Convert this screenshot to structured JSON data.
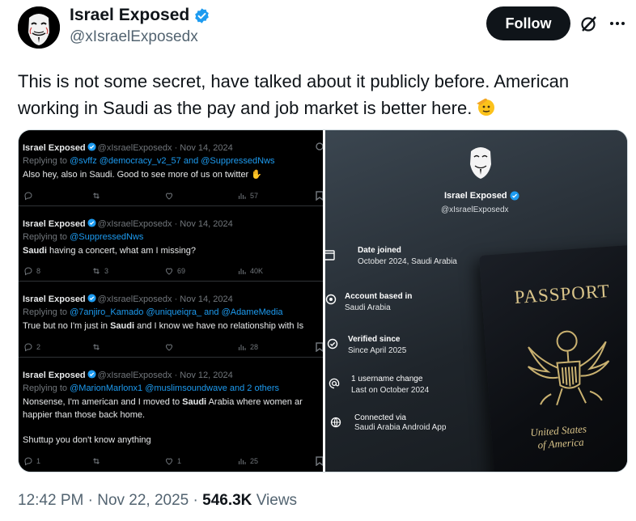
{
  "author": {
    "name": "Israel Exposed",
    "handle": "@xIsraelExposedx"
  },
  "header": {
    "follow_label": "Follow"
  },
  "tweet": {
    "text": "This is not some secret, have talked about it publicly before. American working in Saudi as the pay and job market is better here.",
    "emoji": "saluting-face"
  },
  "left_screenshot": {
    "replies": [
      {
        "name": "Israel Exposed",
        "meta": "@xIsraelExposedx · Nov 14, 2024",
        "replying_prefix": "Replying to",
        "mentions": "@svffz @democracy_v2_57 and @SuppressedNws",
        "body": "Also hey, also in Saudi. Good to see more of us on twitter",
        "replies_count": "",
        "reposts_count": "",
        "likes_count": "",
        "views_count": "57"
      },
      {
        "name": "Israel Exposed",
        "meta": "@xIsraelExposedx · Nov 14, 2024",
        "replying_prefix": "Replying to",
        "mentions": "@SuppressedNws",
        "body_bold": "Saudi",
        "body": "having a concert, what am I missing?",
        "replies_count": "8",
        "reposts_count": "3",
        "likes_count": "69",
        "views_count": "40K"
      },
      {
        "name": "Israel Exposed",
        "meta": "@xIsraelExposedx · Nov 14, 2024",
        "replying_prefix": "Replying to",
        "mentions": "@7anjiro_Kamado @uniqueiqra_ and @AdameMedia",
        "body_pre": "True but no I'm just in",
        "body_bold": "Saudi",
        "body_post": "and I know we have no relationship with Is",
        "replies_count": "2",
        "reposts_count": "",
        "likes_count": "",
        "views_count": "28"
      },
      {
        "name": "Israel Exposed",
        "meta": "@xIsraelExposedx · Nov 12, 2024",
        "replying_prefix": "Replying to",
        "mentions": "@MarionMarlonx1 @muslimsoundwave and 2 others",
        "body_pre": "Nonsense, I'm american and I moved to",
        "body_bold": "Saudi",
        "body_post": "Arabia where women ar",
        "body_line2": "happier than those back home.",
        "body_line3": "Shuttup you don't know anything",
        "replies_count": "1",
        "reposts_count": "",
        "likes_count": "1",
        "views_count": "25"
      }
    ]
  },
  "right_screenshot": {
    "name": "Israel Exposed",
    "handle": "@xIsraelExposedx",
    "info": [
      {
        "icon": "calendar-icon",
        "title": "Date joined",
        "value": "October 2024, Saudi Arabia"
      },
      {
        "icon": "location-icon",
        "title": "Account based in",
        "value": "Saudi Arabia"
      },
      {
        "icon": "verified-check-icon",
        "title": "Verified since",
        "value": "Since April 2025"
      },
      {
        "icon": "at-sign-icon",
        "title": "1 username change",
        "value": "Last on October 2024"
      },
      {
        "icon": "globe-icon",
        "title": "Connected via",
        "value": "Saudi Arabia Android App"
      }
    ],
    "passport": {
      "title": "PASSPORT",
      "country_line1": "United States",
      "country_line2": "of America"
    }
  },
  "footer": {
    "time": "12:42 PM",
    "separator": "·",
    "date": "Nov 22, 2025",
    "views_count": "546.3K",
    "views_label": "Views"
  },
  "colors": {
    "verified": "#1d9bf0",
    "text_primary": "#0f1419",
    "text_secondary": "#536471",
    "follow_bg": "#0f1419"
  }
}
